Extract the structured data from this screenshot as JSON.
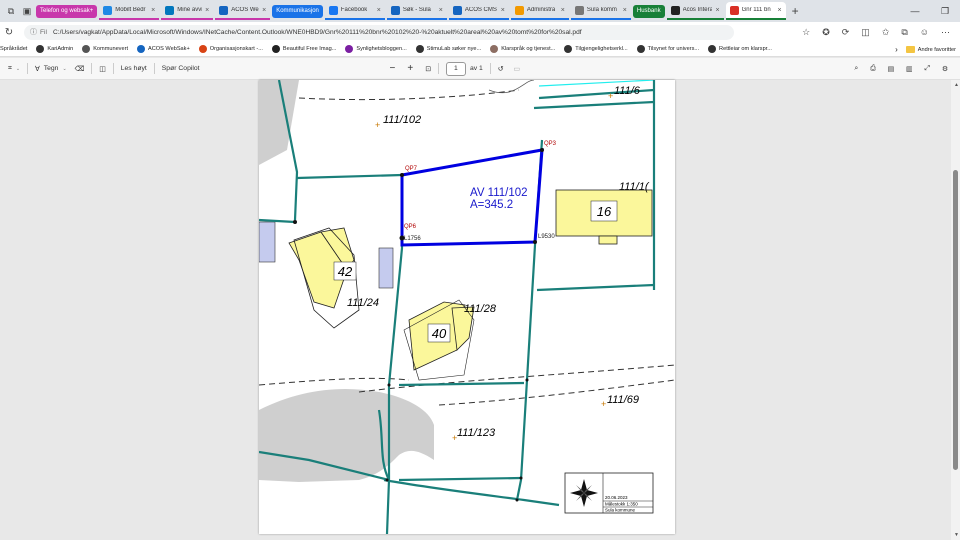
{
  "browser": {
    "tabs": [
      {
        "group": "Telefon og websak+",
        "group_color": "#c837ab"
      },
      {
        "label": "Mobilt Bedr",
        "icon_color": "#1e88e5"
      },
      {
        "label": "Mine avvik",
        "icon_color": "#0277bd"
      },
      {
        "label": "ACOS WebS",
        "icon_color": "#1565c0"
      },
      {
        "group": "Kommunikasjon",
        "group_color": "#1a73e8"
      },
      {
        "label": "Facebook",
        "icon_color": "#1877f2"
      },
      {
        "label": "Søk - Sula",
        "icon_color": "#1565c0"
      },
      {
        "label": "ACOS CMS",
        "icon_color": "#1565c0"
      },
      {
        "label": "Administra",
        "icon_color": "#f29900"
      },
      {
        "label": "Sula komm",
        "icon_color": "#777777"
      },
      {
        "group": "Husbank",
        "group_color": "#188038"
      },
      {
        "label": "Acos Intera",
        "icon_color": "#222222"
      },
      {
        "label": "Gnr 111 bn",
        "icon_color": "#d93025",
        "active": true
      }
    ]
  },
  "address": {
    "fil_label": "Fil",
    "url": "C:/Users/vagkat/AppData/Local/Microsoft/Windows/INetCache/Content.Outlook/WNE0HBD9/Gnr%20111%20bnr%20102%20-%20aktuelt%20areal%20av%20tomt%20for%20sal.pdf"
  },
  "favorites": [
    {
      "label": "Språkrådet",
      "color": "#2e7d32"
    },
    {
      "label": "KariAdmin",
      "color": "#333333"
    },
    {
      "label": "Kommunevert",
      "color": "#555555"
    },
    {
      "label": "ACOS WebSak+",
      "color": "#1565c0"
    },
    {
      "label": "Organisasjonskart -...",
      "color": "#d84315"
    },
    {
      "label": "Beautiful Free Imag...",
      "color": "#222222"
    },
    {
      "label": "Synlighetsbloggen...",
      "color": "#7b1fa2"
    },
    {
      "label": "StimuLab søker nye...",
      "color": "#333333"
    },
    {
      "label": "Klarspråk og tjenest...",
      "color": "#8d6e63"
    },
    {
      "label": "Tilgjengelighetserkl...",
      "color": "#333333"
    },
    {
      "label": "Tilsynet for univers...",
      "color": "#333333"
    },
    {
      "label": "Rettleiar om klarspr...",
      "color": "#333333"
    }
  ],
  "favorites_folder": "Andre favoritter",
  "pdf_toolbar": {
    "draw_label": "Tegn",
    "read_aloud": "Les høyt",
    "copilot": "Spør Copilot",
    "page_number": "1",
    "page_total": "av 1",
    "minus": "−",
    "plus": "+"
  },
  "map": {
    "labels": {
      "parcel_111_6": "111/6",
      "parcel_111_102": "111/102",
      "parcel_111_1x": "111/1(",
      "parcel_111_24": "111/24",
      "parcel_111_28": "111/28",
      "parcel_111_69": "111/69",
      "parcel_111_123": "111/123",
      "house_16": "16",
      "house_42": "42",
      "house_40": "40",
      "area_title": "AV 111/102",
      "area_value": "A=345.2",
      "qp3": "QP3",
      "qp7": "QP7",
      "qp6": "QP6",
      "l1756": "L1756",
      "l9530": "L9530"
    },
    "legend": {
      "date": "20.06.2023",
      "scale": "Målestokk 1:350",
      "municipality": "Sula kommune"
    }
  },
  "colors": {
    "parcel_line": "#1a7f7a",
    "area_outline": "#0000e0",
    "building_fill": "#fbf79b",
    "neighbor_fill": "#c5cbee",
    "road_fill": "#cfcfcf",
    "label_red": "#b00000"
  }
}
